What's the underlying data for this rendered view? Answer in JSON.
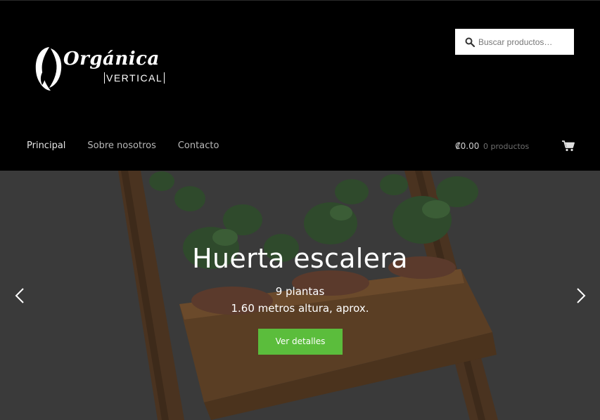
{
  "brand": {
    "name": "Orgánica",
    "tagline": "VERTICAL"
  },
  "search": {
    "placeholder": "Buscar productos…",
    "icon": "search-icon"
  },
  "nav": {
    "items": [
      {
        "label": "Principal",
        "active": true
      },
      {
        "label": "Sobre nosotros",
        "active": false
      },
      {
        "label": "Contacto",
        "active": false
      }
    ]
  },
  "cart": {
    "amount": "₡0.00",
    "count": "0 productos",
    "icon": "cart-icon"
  },
  "slider": {
    "title": "Huerta escalera",
    "line1": "9 plantas",
    "line2": "1.60 metros altura, aprox.",
    "button_label": "Ver detalles",
    "prev_icon": "chevron-left-icon",
    "next_icon": "chevron-right-icon"
  },
  "colors": {
    "header_bg": "#000000",
    "button_green": "#5bbd3c",
    "hero_overlay": "#3b3b3b"
  }
}
